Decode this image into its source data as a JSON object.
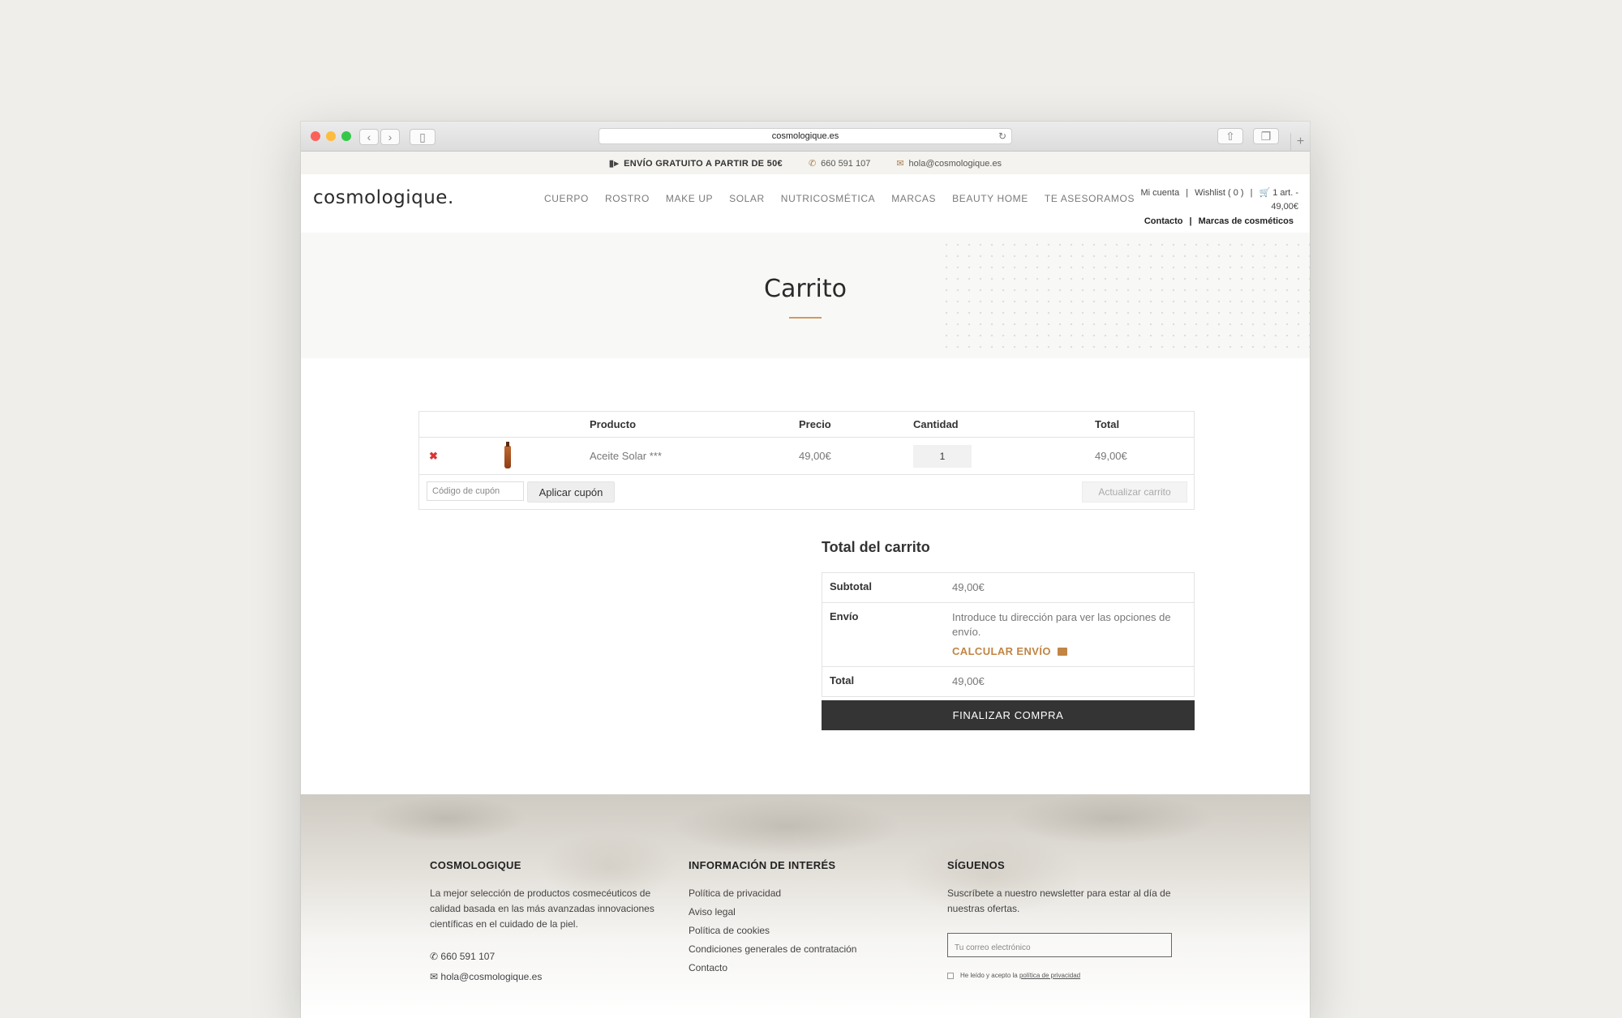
{
  "browser": {
    "url": "cosmologique.es",
    "traffic_colors": [
      "#fc605b",
      "#fdbc40",
      "#34c84a"
    ]
  },
  "topbar": {
    "shipping": "ENVÍO GRATUITO A PARTIR DE 50€",
    "phone": "660 591 107",
    "email": "hola@cosmologique.es"
  },
  "header": {
    "logo": "cosmologique.",
    "menu": [
      "CUERPO",
      "ROSTRO",
      "MAKE UP",
      "SOLAR",
      "NUTRICOSMÉTICA",
      "MARCAS",
      "BEAUTY HOME",
      "TE ASESORAMOS"
    ],
    "account": "Mi cuenta",
    "wishlist": "Wishlist ( 0 )",
    "cart_summary": "1 art. -",
    "cart_total": "49,00€",
    "contact": "Contacto",
    "brands": "Marcas de cosméticos"
  },
  "page": {
    "title": "Carrito",
    "accent": "#d19a5f"
  },
  "cart": {
    "headers": [
      "Producto",
      "Precio",
      "Cantidad",
      "Total"
    ],
    "items": [
      {
        "name": "Aceite Solar ***",
        "price": "49,00€",
        "qty": "1",
        "total": "49,00€"
      }
    ],
    "coupon_placeholder": "Código de cupón",
    "apply_coupon": "Aplicar cupón",
    "update_cart": "Actualizar carrito"
  },
  "totals": {
    "title": "Total del carrito",
    "subtotal_label": "Subtotal",
    "subtotal": "49,00€",
    "shipping_label": "Envío",
    "shipping_note": "Introduce tu dirección para ver las opciones de envío.",
    "calc_shipping": "CALCULAR ENVÍO",
    "total_label": "Total",
    "total": "49,00€",
    "checkout": "FINALIZAR COMPRA"
  },
  "footer": {
    "col1_title": "COSMOLOGIQUE",
    "col1_text": "La mejor selección de productos cosmecéuticos de calidad basada en las más avanzadas innovaciones científicas en el cuidado de la piel.",
    "phone": "660 591 107",
    "email": "hola@cosmologique.es",
    "col2_title": "INFORMACIÓN DE INTERÉS",
    "links": [
      "Política de privacidad",
      "Aviso legal",
      "Política de cookies",
      "Condiciones generales de contratación",
      "Contacto"
    ],
    "col3_title": "SÍGUENOS",
    "col3_text": "Suscríbete a nuestro newsletter para estar al día de nuestras ofertas.",
    "newsletter_placeholder": "Tu correo electrónico",
    "consent_text": "He leído y acepto la",
    "consent_link": "política de privacidad"
  }
}
